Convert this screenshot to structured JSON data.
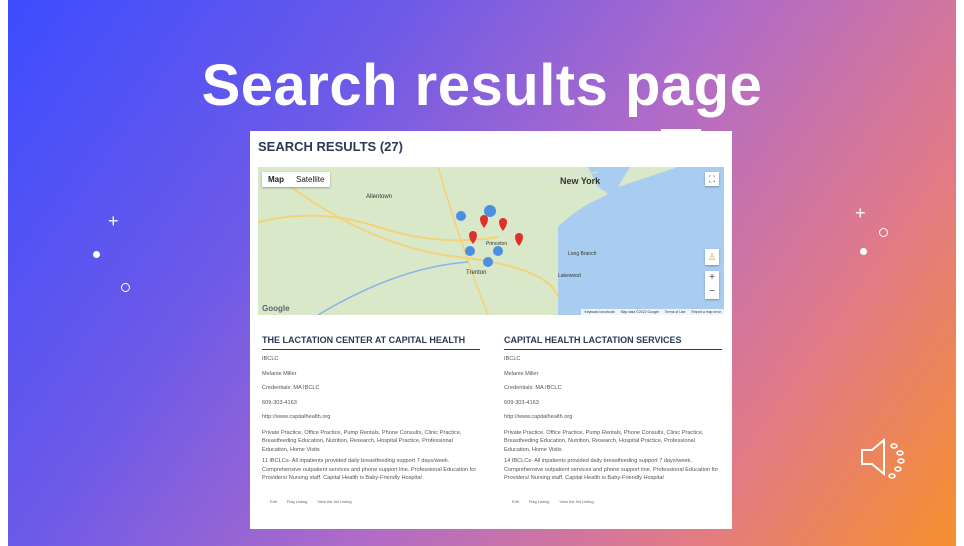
{
  "slide": {
    "title": "Search results page"
  },
  "panel": {
    "header": "SEARCH RESULTS (27)",
    "map": {
      "tabs": [
        "Map",
        "Satellite"
      ],
      "fullscreen_icon": "⛶",
      "pegman_icon": "♙",
      "zoom_in": "+",
      "zoom_out": "−",
      "footer": [
        "Keyboard shortcuts",
        "Map data ©2022 Google",
        "Terms of Use",
        "Report a map error"
      ],
      "logo": "Google",
      "places": [
        "New York",
        "Allentown",
        "Trenton",
        "Princeton",
        "Long Branch",
        "Lakewood"
      ],
      "water_color": "#a9cdf0",
      "land_color": "#d9e8c9"
    },
    "listings": [
      {
        "name": "THE LACTATION CENTER AT CAPITAL HEALTH",
        "type": "IBCLC",
        "contact": "Melanie  Miller",
        "credentials": "Credentials:  MA IBCLC",
        "phone": "609-303-4163",
        "website": "http://www.capitalhealth.org",
        "services": "Private Practice, Office Practice, Pump Rentals, Phone Consults, Clinic Practice, Breastfeeding Education, Nutrition, Research, Hospital Practice, Professional Education, Home Visits",
        "description": "11 IBCLCs- All inpatients provided daily breastfeeding support 7 days/week. Comprehensive outpatient services and phone support line. Professional Education for Providers/ Nursing staff. Capital Health is Baby-Friendly Hospital",
        "actions": [
          "Edit",
          "Flag Listing",
          "View the full Listing"
        ]
      },
      {
        "name": "CAPITAL HEALTH LACTATION SERVICES",
        "type": "IBCLC",
        "contact": "Melanie  Miller",
        "credentials": "Credentials:  MA IBCLC",
        "phone": "609-303-4163",
        "website": "http://www.capitalhealth.org",
        "services": "Private Practice, Office Practice, Pump Rentals, Phone Consults, Clinic Practice, Breastfeeding Education, Nutrition, Research, Hospital Practice, Professional Education, Home Visits",
        "description": "14 IBCLCs- All inpatients provided daily breastfeeding support 7 days/week. Comprehensive outpatient services and phone support line. Professional Education for Providers/ Nursing staff. Capital Health is Baby-Friendly Hospital",
        "actions": [
          "Edit",
          "Flag Listing",
          "View the full Listing"
        ]
      }
    ]
  },
  "decorations": {
    "plus": "+",
    "speaker_icon": "speaker-icon"
  }
}
